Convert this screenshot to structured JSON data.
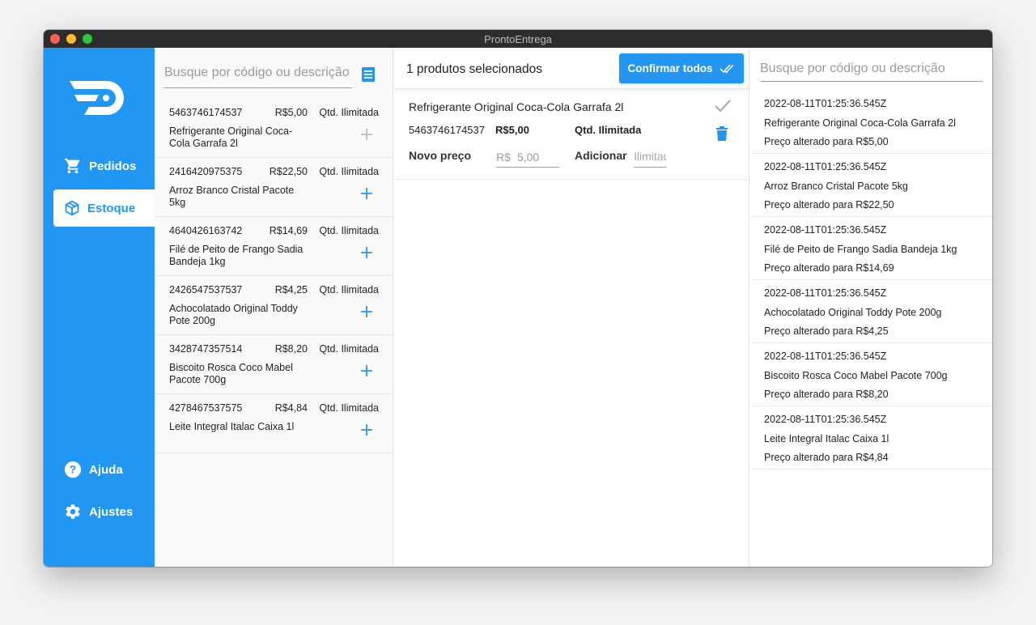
{
  "window": {
    "title": "ProntoEntrega"
  },
  "sidebar": {
    "items": [
      {
        "label": "Pedidos",
        "icon": "cart-icon"
      },
      {
        "label": "Estoque",
        "icon": "package-icon"
      },
      {
        "label": "Ajuda",
        "icon": "help-icon"
      },
      {
        "label": "Ajustes",
        "icon": "gear-icon"
      }
    ],
    "active": "Estoque",
    "accent": "#2196f3"
  },
  "products": {
    "search_placeholder": "Busque por código ou descrição",
    "items": [
      {
        "code": "5463746174537",
        "price": "R$5,00",
        "qty": "Qtd. Ilimitada",
        "name": "Refrigerante Original Coca-Cola Garrafa 2l",
        "selected": true
      },
      {
        "code": "2416420975375",
        "price": "R$22,50",
        "qty": "Qtd. Ilimitada",
        "name": "Arroz Branco Cristal Pacote 5kg"
      },
      {
        "code": "4640426163742",
        "price": "R$14,69",
        "qty": "Qtd. Ilimitada",
        "name": "Filé de Peito de Frango Sadia Bandeja 1kg"
      },
      {
        "code": "2426547537537",
        "price": "R$4,25",
        "qty": "Qtd. Ilimitada",
        "name": "Achocolatado Original Toddy Pote 200g"
      },
      {
        "code": "3428747357514",
        "price": "R$8,20",
        "qty": "Qtd. Ilimitada",
        "name": "Biscoito Rosca Coco Mabel Pacote 700g"
      },
      {
        "code": "4278467537575",
        "price": "R$4,84",
        "qty": "Qtd. Ilimitada",
        "name": "Leite Integral Italac Caixa 1l"
      }
    ]
  },
  "selection": {
    "count_label": "1 produtos selecionados",
    "confirm_label": "Confirmar todos",
    "item": {
      "name": "Refrigerante Original Coca-Cola Garrafa 2l",
      "code": "5463746174537",
      "price": "R$5,00",
      "qty": "Qtd. Ilimitada",
      "new_price_label": "Novo preço",
      "currency": "R$",
      "new_price_value": "5,00",
      "add_label": "Adicionar",
      "add_placeholder": "Ilimitada"
    }
  },
  "history": {
    "search_placeholder": "Busque por código ou descrição",
    "items": [
      {
        "timestamp": "2022-08-11T01:25:36.545Z",
        "name": "Refrigerante Original Coca-Cola Garrafa 2l",
        "message": "Preço alterado para R$5,00"
      },
      {
        "timestamp": "2022-08-11T01:25:36.545Z",
        "name": "Arroz Branco Cristal Pacote 5kg",
        "message": "Preço alterado para R$22,50"
      },
      {
        "timestamp": "2022-08-11T01:25:36.545Z",
        "name": "Filé de Peito de Frango Sadia Bandeja 1kg",
        "message": "Preço alterado para R$14,69"
      },
      {
        "timestamp": "2022-08-11T01:25:36.545Z",
        "name": "Achocolatado Original Toddy Pote 200g",
        "message": "Preço alterado para R$4,25"
      },
      {
        "timestamp": "2022-08-11T01:25:36.545Z",
        "name": "Biscoito Rosca Coco Mabel Pacote 700g",
        "message": "Preço alterado para R$8,20"
      },
      {
        "timestamp": "2022-08-11T01:25:36.545Z",
        "name": "Leite Integral Italac Caixa 1l",
        "message": "Preço alterado para R$4,84"
      }
    ]
  }
}
